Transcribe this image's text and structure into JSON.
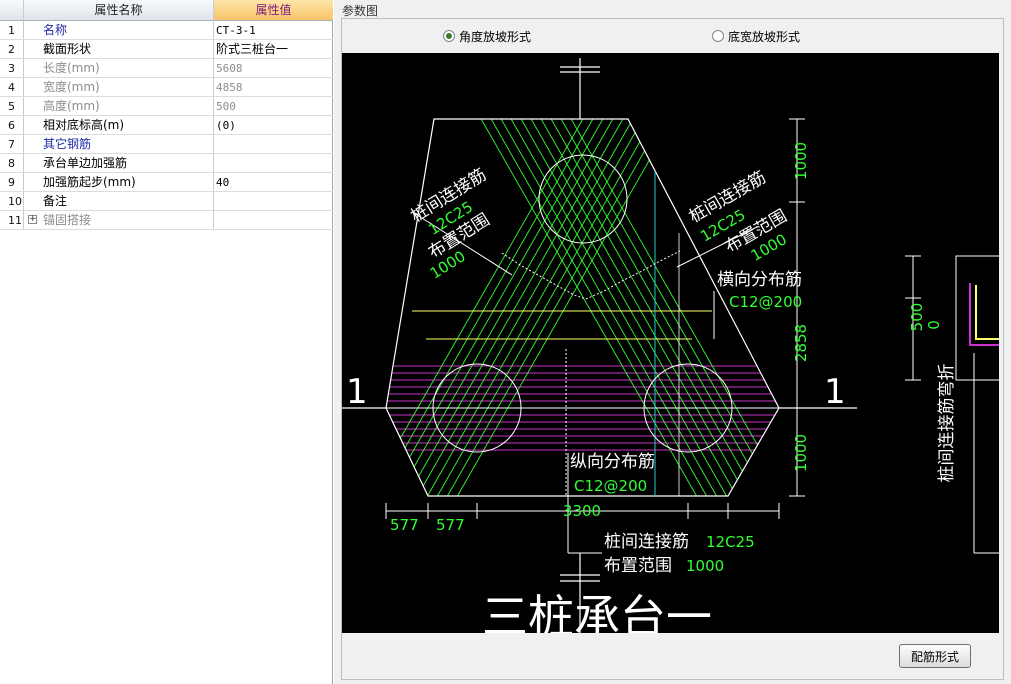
{
  "grid": {
    "header": {
      "name": "属性名称",
      "value": "属性值"
    },
    "rows": [
      {
        "num": "1",
        "name": "名称",
        "value": "CT-3-1"
      },
      {
        "num": "2",
        "name": "截面形状",
        "value": "阶式三桩台一"
      },
      {
        "num": "3",
        "name": "长度(mm)",
        "value": "5608"
      },
      {
        "num": "4",
        "name": "宽度(mm)",
        "value": "4858"
      },
      {
        "num": "5",
        "name": "高度(mm)",
        "value": "500"
      },
      {
        "num": "6",
        "name": "相对底标高(m)",
        "value": "(0)"
      },
      {
        "num": "7",
        "name": "其它钢筋",
        "value": ""
      },
      {
        "num": "8",
        "name": "承台单边加强筋",
        "value": ""
      },
      {
        "num": "9",
        "name": "加强筋起步(mm)",
        "value": "40"
      },
      {
        "num": "10",
        "name": "备注",
        "value": ""
      },
      {
        "num": "11",
        "name": "锚固搭接",
        "value": "",
        "expander": "+"
      }
    ]
  },
  "panel": {
    "title": "参数图",
    "radio_angle": "角度放坡形式",
    "radio_width": "底宽放坡形式",
    "rebar_button": "配筋形式"
  },
  "drawing": {
    "title": "三桩承台一",
    "section_marker": "1",
    "dims": {
      "top": "1000",
      "middle": "2858",
      "bottom": "1000",
      "width": "3300",
      "edge": "577",
      "right_500": "500",
      "right_0": "0"
    },
    "labels": {
      "pile_link_bar": "桩间连接筋",
      "bar_spec": "12C25",
      "layout_range": "布置范围",
      "range_value": "1000",
      "transverse_bar": "横向分布筋",
      "transverse_spec": "C12@200",
      "longitudinal_bar": "纵向分布筋",
      "longitudinal_spec": "C12@200",
      "bottom_link": "桩间连接筋",
      "bottom_link_spec": "12C25",
      "bottom_range": "布置范围",
      "bottom_range_value": "1000",
      "bend_label": "桩间连接筋弯折"
    },
    "colors": {
      "bars": "#33ff33",
      "magenta": "#cc33cc",
      "lines": "#ffffff",
      "cyan": "#22cccc",
      "yellow": "#ffff66"
    }
  }
}
